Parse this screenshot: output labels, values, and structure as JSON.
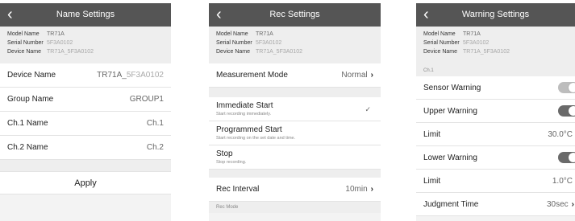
{
  "screen1": {
    "title": "Name Settings",
    "info": {
      "model_label": "Model Name",
      "model": "TR71A",
      "serial_label": "Serial Number",
      "serial": "5F3A0102",
      "device_label": "Device Name",
      "device": "TR71A_5F3A0102"
    },
    "items": [
      {
        "label": "Device Name",
        "value_prefix": "TR71A_",
        "value_faint": "5F3A0102"
      },
      {
        "label": "Group Name",
        "value": "GROUP1"
      },
      {
        "label": "Ch.1 Name",
        "value": "Ch.1"
      },
      {
        "label": "Ch.2 Name",
        "value": "Ch.2"
      }
    ],
    "apply_label": "Apply"
  },
  "screen2": {
    "title": "Rec Settings",
    "info": {
      "model_label": "Model Name",
      "model": "TR71A",
      "serial_label": "Serial Number",
      "serial": "5F3A0102",
      "device_label": "Device Name",
      "device": "TR71A_5F3A0102"
    },
    "measurement": {
      "label": "Measurement Mode",
      "value": "Normal"
    },
    "options": [
      {
        "title": "Immediate Start",
        "sub": "Start recording immediately.",
        "check": "✓"
      },
      {
        "title": "Programmed Start",
        "sub": "Start recording on the set date and time."
      },
      {
        "title": "Stop",
        "sub": "Stop recording."
      }
    ],
    "interval": {
      "label": "Rec Interval",
      "value": "10min"
    },
    "section": "Rec Mode"
  },
  "screen3": {
    "title": "Warning Settings",
    "info": {
      "model_label": "Model Name",
      "model": "TR71A",
      "serial_label": "Serial Number",
      "serial": "5F3A0102",
      "device_label": "Device Name",
      "device": "TR71A_5F3A0102"
    },
    "section": "Ch.1",
    "sensor": {
      "label": "Sensor Warning"
    },
    "upper": {
      "label": "Upper Warning"
    },
    "limit1": {
      "label": "Limit",
      "value": "30.0°C"
    },
    "lower": {
      "label": "Lower Warning"
    },
    "limit2": {
      "label": "Limit",
      "value": "1.0°C"
    },
    "judgment": {
      "label": "Judgment Time",
      "value": "30sec"
    }
  },
  "icons": {
    "back": "back-chevron-icon",
    "chevron": "chevron-right-icon",
    "check": "checkmark-icon"
  },
  "colors": {
    "header": "#555555",
    "toggle_on": "#6a6a6a",
    "toggle_off": "#bdbdbd"
  }
}
